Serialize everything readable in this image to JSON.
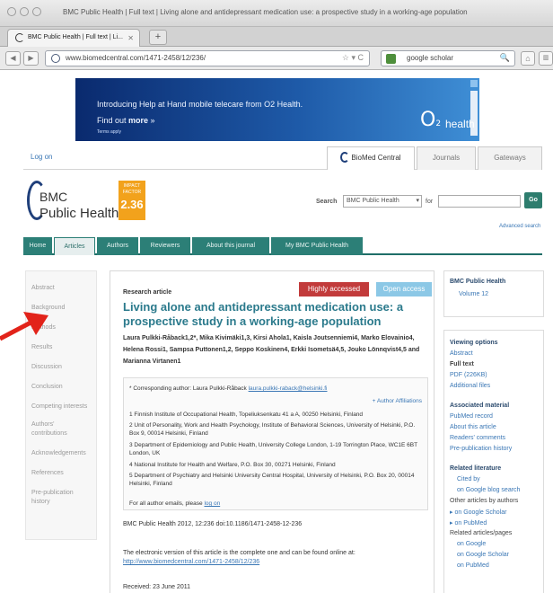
{
  "window": {
    "title": "BMC Public Health | Full text | Living alone and antidepressant medication use: a prospective study in a working-age population"
  },
  "tab": {
    "label": "BMC Public Health | Full text | Li...",
    "close_glyph": "✕",
    "new_tab_glyph": "+"
  },
  "navbar": {
    "back_glyph": "◀",
    "forward_glyph": "▶",
    "url": "www.biomedcentral.com/1471-2458/12/236/",
    "url_icons": "☆ ▾ C",
    "search_text": "google scholar",
    "search_glyph": "🔍",
    "home_glyph": "⌂",
    "more_glyph": "▥"
  },
  "ad": {
    "line1": "Introducing Help at Hand mobile telecare from O2 Health.",
    "line2_prefix": "Find out ",
    "line2_bold": "more",
    "line2_suffix": " »",
    "terms": "Terms apply",
    "logo_mark": "O",
    "logo_sub": "2",
    "logo_text": "health"
  },
  "topbar": {
    "login": "Log on",
    "tabs": [
      "BioMed Central",
      "Journals",
      "Gateways"
    ]
  },
  "journal": {
    "logo_line1": "BMC",
    "logo_line2": "Public Health",
    "impact_label": "IMPACT FACTOR",
    "impact_value": "2.36"
  },
  "search": {
    "label": "Search",
    "scope": "BMC Public Health",
    "for_label": "for",
    "go_label": "Go",
    "advanced": "Advanced search"
  },
  "mainnav": [
    "Home",
    "Articles",
    "Authors",
    "Reviewers",
    "About this journal",
    "My BMC Public Health"
  ],
  "sidebar": [
    "Abstract",
    "Background",
    "Methods",
    "Results",
    "Discussion",
    "Conclusion",
    "Competing interests",
    "Authors'",
    "contributions",
    "Acknowledgements",
    "References",
    "Pre-publication",
    "history"
  ],
  "article": {
    "type": "Research article",
    "badge_highly": "Highly accessed",
    "badge_open": "Open access",
    "title": "Living alone and antidepressant medication use: a prospective study in a working-age population",
    "authors": "Laura Pulkki-Råback1,2*, Mika Kivimäki1,3, Kirsi Ahola1, Kaisla Joutsenniemi4, Marko Elovainio4, Helena Rossi1, Sampsa Puttonen1,2, Seppo Koskinen4, Erkki Isometsä4,5, Jouko Lönnqvist4,5 and Marianna Virtanen1",
    "corresponding_prefix": "* Corresponding author: Laura Pulkki-Råback ",
    "corresponding_email": "laura.pulkki-raback@helsinki.fi",
    "affil_toggle": "+ Author Affiliations",
    "affiliations": [
      "1 Finnish Institute of Occupational Health, Topeliuksenkatu 41 a A, 00250 Helsinki, Finland",
      "2 Unit of Personality, Work and Health Psychology, Institute of Behavioral Sciences, University of Helsinki, P.O. Box 9, 00014 Helsinki, Finland",
      "3 Department of Epidemiology and Public Health, University College London, 1-19 Torrington Place, WC1E 6BT London, UK",
      "4 National Institute for Health and Welfare, P.O. Box 30, 00271 Helsinki, Finland",
      "5 Department of Psychiatry and Helsinki University Central Hospital, University of Helsinki, P.O. Box 20, 00014 Helsinki, Finland"
    ],
    "emails_line_prefix": "For all author emails, please ",
    "emails_link": "log on",
    "citation": "BMC Public Health 2012, 12:236     doi:10.1186/1471-2458-12-236",
    "ev_line": "The electronic version of this article is the complete one and can be found online at:",
    "ev_url": "http://www.biomedcentral.com/1471-2458/12/236",
    "received": "Received:   23 June 2011"
  },
  "rightcol": {
    "journal_head": "BMC Public Health",
    "volume": "Volume 12",
    "viewing_head": "Viewing options",
    "viewing": [
      "Abstract",
      "Full text",
      "PDF (226KB)",
      "Additional files"
    ],
    "assoc_head": "Associated material",
    "assoc": [
      "PubMed record",
      "About this article",
      "Readers' comments",
      "Pre-publication history"
    ],
    "related_head": "Related literature",
    "related": [
      "Cited by",
      "on Google blog search",
      "Other articles by authors",
      "▸ on Google Scholar",
      "▸ on PubMed",
      "Related articles/pages",
      "on Google",
      "on Google Scholar",
      "on PubMed"
    ]
  }
}
